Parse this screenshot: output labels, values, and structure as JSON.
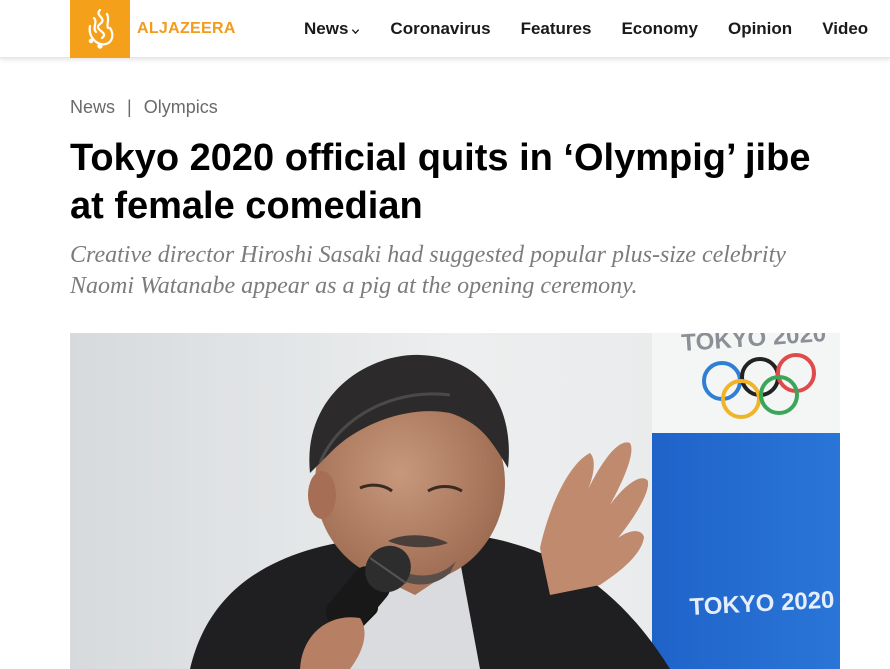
{
  "header": {
    "logo_text": "ALJAZEERA",
    "nav": [
      {
        "label": "News",
        "has_dropdown": true
      },
      {
        "label": "Coronavirus"
      },
      {
        "label": "Features"
      },
      {
        "label": "Economy"
      },
      {
        "label": "Opinion"
      },
      {
        "label": "Video"
      }
    ]
  },
  "breadcrumb": {
    "items": [
      "News",
      "Olympics"
    ],
    "separator": "|"
  },
  "article": {
    "title": "Tokyo 2020 official quits in ‘Olympig’ jibe at female comedian",
    "subtitle": "Creative director Hiroshi Sasaki had suggested popular plus-size celebrity Naomi Watanabe appear as a pig at the opening ceremony.",
    "hero_image": {
      "backdrop_text_top": "TOKYO 2020",
      "backdrop_text_panel": "TOKYO 2020"
    }
  },
  "colors": {
    "brand": "#f5a01a",
    "panel_blue": "#1f63c9"
  }
}
